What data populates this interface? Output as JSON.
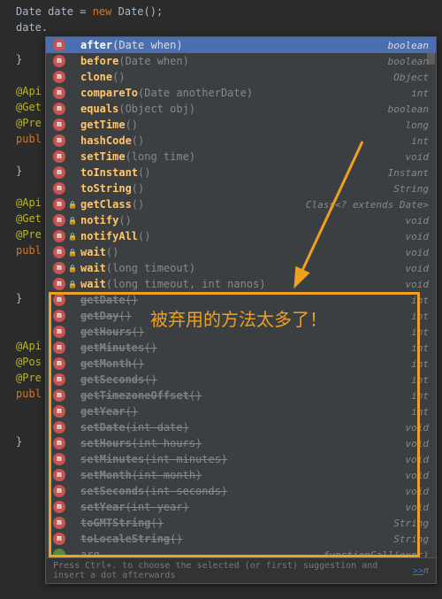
{
  "code": {
    "line1_pre": "Date date = ",
    "line1_kw": "new",
    "line1_post": " Date();",
    "line2": "date.",
    "brace": "}",
    "anno_api": "@Api",
    "anno_get": "@Get",
    "anno_pre": "@Pre",
    "anno_post": "@Pos",
    "mod_publ": "publ"
  },
  "items": [
    {
      "name": "after",
      "params": "(Date when)",
      "ret": "boolean",
      "dep": false,
      "sel": true,
      "lock": ""
    },
    {
      "name": "before",
      "params": "(Date when)",
      "ret": "boolean",
      "dep": false,
      "lock": ""
    },
    {
      "name": "clone",
      "params": "()",
      "ret": "Object",
      "dep": false,
      "lock": ""
    },
    {
      "name": "compareTo",
      "params": "(Date anotherDate)",
      "ret": "int",
      "dep": false,
      "lock": ""
    },
    {
      "name": "equals",
      "params": "(Object obj)",
      "ret": "boolean",
      "dep": false,
      "lock": ""
    },
    {
      "name": "getTime",
      "params": "()",
      "ret": "long",
      "dep": false,
      "lock": ""
    },
    {
      "name": "hashCode",
      "params": "()",
      "ret": "int",
      "dep": false,
      "lock": ""
    },
    {
      "name": "setTime",
      "params": "(long time)",
      "ret": "void",
      "dep": false,
      "lock": ""
    },
    {
      "name": "toInstant",
      "params": "()",
      "ret": "Instant",
      "dep": false,
      "lock": ""
    },
    {
      "name": "toString",
      "params": "()",
      "ret": "String",
      "dep": false,
      "lock": ""
    },
    {
      "name": "getClass",
      "params": "()",
      "ret": "Class<? extends Date>",
      "dep": false,
      "lock": "🔒"
    },
    {
      "name": "notify",
      "params": "()",
      "ret": "void",
      "dep": false,
      "lock": "🔒"
    },
    {
      "name": "notifyAll",
      "params": "()",
      "ret": "void",
      "dep": false,
      "lock": "🔒"
    },
    {
      "name": "wait",
      "params": "()",
      "ret": "void",
      "dep": false,
      "lock": "🔒"
    },
    {
      "name": "wait",
      "params": "(long timeout)",
      "ret": "void",
      "dep": false,
      "lock": "🔒"
    },
    {
      "name": "wait",
      "params": "(long timeout, int nanos)",
      "ret": "void",
      "dep": false,
      "lock": "🔒"
    },
    {
      "name": "getDate",
      "params": "()",
      "ret": "int",
      "dep": true,
      "lock": ""
    },
    {
      "name": "getDay",
      "params": "()",
      "ret": "int",
      "dep": true,
      "lock": ""
    },
    {
      "name": "getHours",
      "params": "()",
      "ret": "int",
      "dep": true,
      "lock": ""
    },
    {
      "name": "getMinutes",
      "params": "()",
      "ret": "int",
      "dep": true,
      "lock": ""
    },
    {
      "name": "getMonth",
      "params": "()",
      "ret": "int",
      "dep": true,
      "lock": ""
    },
    {
      "name": "getSeconds",
      "params": "()",
      "ret": "int",
      "dep": true,
      "lock": ""
    },
    {
      "name": "getTimezoneOffset",
      "params": "()",
      "ret": "int",
      "dep": true,
      "lock": ""
    },
    {
      "name": "getYear",
      "params": "()",
      "ret": "int",
      "dep": true,
      "lock": ""
    },
    {
      "name": "setDate",
      "params": "(int date)",
      "ret": "void",
      "dep": true,
      "lock": ""
    },
    {
      "name": "setHours",
      "params": "(int hours)",
      "ret": "void",
      "dep": true,
      "lock": ""
    },
    {
      "name": "setMinutes",
      "params": "(int minutes)",
      "ret": "void",
      "dep": true,
      "lock": ""
    },
    {
      "name": "setMonth",
      "params": "(int month)",
      "ret": "void",
      "dep": true,
      "lock": ""
    },
    {
      "name": "setSeconds",
      "params": "(int seconds)",
      "ret": "void",
      "dep": true,
      "lock": ""
    },
    {
      "name": "setYear",
      "params": "(int year)",
      "ret": "void",
      "dep": true,
      "lock": ""
    },
    {
      "name": "toGMTString",
      "params": "()",
      "ret": "String",
      "dep": true,
      "lock": ""
    },
    {
      "name": "toLocaleString",
      "params": "()",
      "ret": "String",
      "dep": true,
      "lock": ""
    },
    {
      "name": "arg",
      "params": "",
      "ret": "functionCall(expr)",
      "dep": false,
      "plain": true,
      "lock": ""
    }
  ],
  "footer": {
    "text": "Press Ctrl+. to choose the selected (or first) suggestion and insert a dot afterwards",
    "link": ">>",
    "pi": "π"
  },
  "annotation": "被弃用的方法太多了！"
}
